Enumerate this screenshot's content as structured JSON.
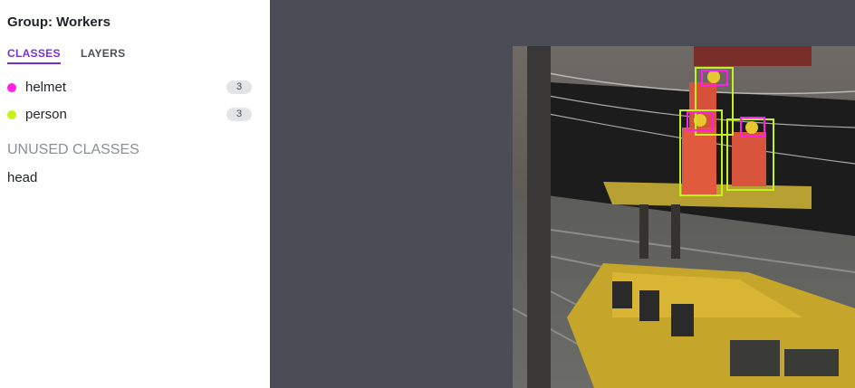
{
  "group": {
    "title": "Group: Workers"
  },
  "tabs": [
    {
      "label": "CLASSES",
      "active": true
    },
    {
      "label": "LAYERS",
      "active": false
    }
  ],
  "classes": [
    {
      "name": "helmet",
      "count": "3",
      "color": "#ff1fe6"
    },
    {
      "name": "person",
      "count": "3",
      "color": "#c6f21c"
    }
  ],
  "unused": {
    "heading": "UNUSED CLASSES",
    "items": [
      "head"
    ]
  },
  "annotations": [
    {
      "class": "person"
    },
    {
      "class": "person"
    },
    {
      "class": "person"
    },
    {
      "class": "helmet"
    },
    {
      "class": "helmet"
    },
    {
      "class": "helmet"
    }
  ]
}
